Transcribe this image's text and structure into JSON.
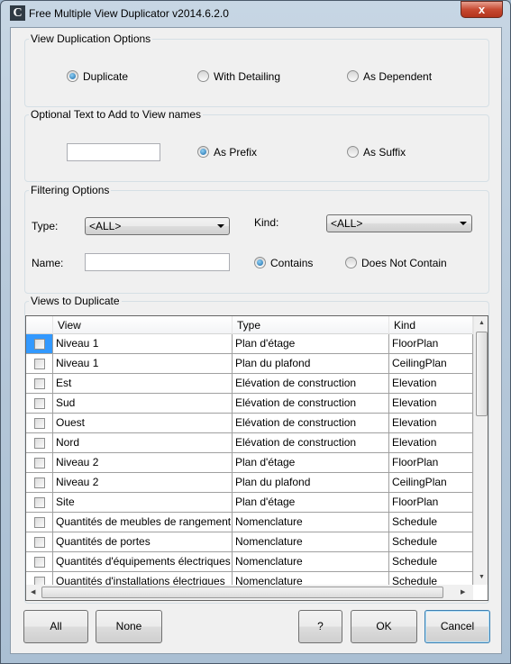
{
  "window": {
    "title": "Free Multiple View Duplicator v2014.6.2.0",
    "icon": "C",
    "close": "x"
  },
  "duplication": {
    "label": "View Duplication Options",
    "options": [
      {
        "label": "Duplicate",
        "selected": true
      },
      {
        "label": "With Detailing",
        "selected": false
      },
      {
        "label": "As Dependent",
        "selected": false
      }
    ]
  },
  "optional_text": {
    "label": "Optional Text to Add to View names",
    "value": "",
    "options": [
      {
        "label": "As Prefix",
        "selected": true
      },
      {
        "label": "As Suffix",
        "selected": false
      }
    ]
  },
  "filtering": {
    "label": "Filtering Options",
    "type_label": "Type:",
    "type_value": "<ALL>",
    "kind_label": "Kind:",
    "kind_value": "<ALL>",
    "name_label": "Name:",
    "name_value": "",
    "options": [
      {
        "label": "Contains",
        "selected": true
      },
      {
        "label": "Does Not Contain",
        "selected": false
      }
    ]
  },
  "views": {
    "label": "Views to Duplicate",
    "columns": [
      "View",
      "Type",
      "Kind"
    ],
    "rows": [
      [
        "Niveau 1",
        "Plan d'étage",
        "FloorPlan"
      ],
      [
        "Niveau 1",
        "Plan du plafond",
        "CeilingPlan"
      ],
      [
        "Est",
        "Elévation de construction",
        "Elevation"
      ],
      [
        "Sud",
        "Elévation de construction",
        "Elevation"
      ],
      [
        "Ouest",
        "Elévation de construction",
        "Elevation"
      ],
      [
        "Nord",
        "Elévation de construction",
        "Elevation"
      ],
      [
        "Niveau 2",
        "Plan d'étage",
        "FloorPlan"
      ],
      [
        "Niveau 2",
        "Plan du plafond",
        "CeilingPlan"
      ],
      [
        "Site",
        "Plan d'étage",
        "FloorPlan"
      ],
      [
        "Quantités de meubles de rangement",
        "Nomenclature",
        "Schedule"
      ],
      [
        "Quantités de portes",
        "Nomenclature",
        "Schedule"
      ],
      [
        "Quantités d'équipements électriques",
        "Nomenclature",
        "Schedule"
      ],
      [
        "Quantités d'installations électriques",
        "Nomenclature",
        "Schedule"
      ]
    ]
  },
  "buttons": {
    "all": "All",
    "none": "None",
    "help": "?",
    "ok": "OK",
    "cancel": "Cancel"
  }
}
